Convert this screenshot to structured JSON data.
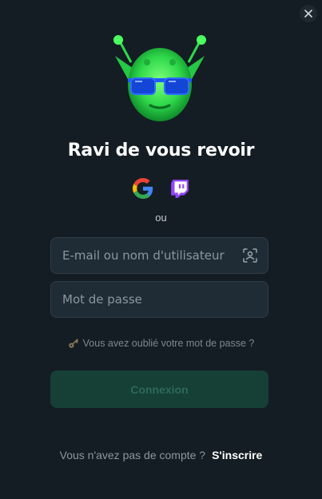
{
  "title": "Ravi de vous revoir",
  "social": {
    "google": "google-icon",
    "twitch": "twitch-icon"
  },
  "separator": "ou",
  "form": {
    "username_placeholder": "E-mail ou nom d'utilisateur",
    "password_placeholder": "Mot de passe",
    "forgot_label": "Vous avez oublié votre mot de passe ?",
    "login_label": "Connexion"
  },
  "signup": {
    "text": "Vous n'avez pas de compte ?",
    "link": "S'inscrire"
  },
  "colors": {
    "background": "#141d23",
    "field": "#202c35",
    "login_button": "#163f35",
    "login_text": "#2d6a58",
    "accent_green": "#39e65a"
  }
}
